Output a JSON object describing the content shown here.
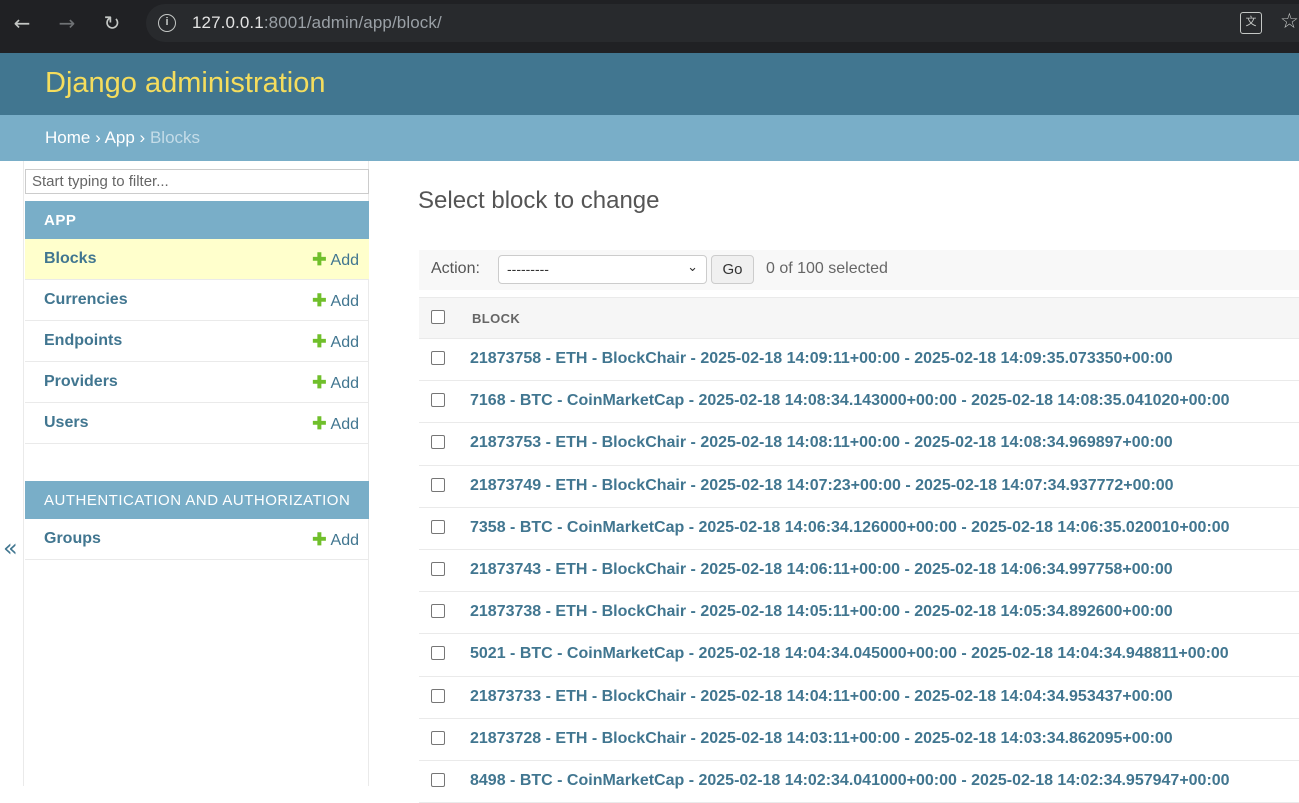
{
  "browser": {
    "url_host": "127.0.0.1",
    "url_rest": ":8001/admin/app/block/"
  },
  "header": {
    "site_name": "Django administration"
  },
  "breadcrumbs": {
    "home": "Home",
    "app": "App",
    "current": "Blocks",
    "separator": "›"
  },
  "sidebar": {
    "toggle_label": "«",
    "filter_placeholder": "Start typing to filter...",
    "modules": [
      {
        "caption": "APP",
        "models": [
          {
            "name": "Blocks",
            "add": "Add",
            "current": true
          },
          {
            "name": "Currencies",
            "add": "Add"
          },
          {
            "name": "Endpoints",
            "add": "Add"
          },
          {
            "name": "Providers",
            "add": "Add"
          },
          {
            "name": "Users",
            "add": "Add"
          }
        ]
      },
      {
        "caption": "AUTHENTICATION AND AUTHORIZATION",
        "models": [
          {
            "name": "Groups",
            "add": "Add"
          }
        ]
      }
    ]
  },
  "content": {
    "title": "Select block to change",
    "action_label": "Action:",
    "action_value": "---------",
    "go_label": "Go",
    "counter": "0 of 100 selected",
    "column_header": "BLOCK",
    "rows": [
      "21873758 - ETH - BlockChair - 2025-02-18 14:09:11+00:00 - 2025-02-18 14:09:35.073350+00:00",
      "7168 - BTC - CoinMarketCap - 2025-02-18 14:08:34.143000+00:00 - 2025-02-18 14:08:35.041020+00:00",
      "21873753 - ETH - BlockChair - 2025-02-18 14:08:11+00:00 - 2025-02-18 14:08:34.969897+00:00",
      "21873749 - ETH - BlockChair - 2025-02-18 14:07:23+00:00 - 2025-02-18 14:07:34.937772+00:00",
      "7358 - BTC - CoinMarketCap - 2025-02-18 14:06:34.126000+00:00 - 2025-02-18 14:06:35.020010+00:00",
      "21873743 - ETH - BlockChair - 2025-02-18 14:06:11+00:00 - 2025-02-18 14:06:34.997758+00:00",
      "21873738 - ETH - BlockChair - 2025-02-18 14:05:11+00:00 - 2025-02-18 14:05:34.892600+00:00",
      "5021 - BTC - CoinMarketCap - 2025-02-18 14:04:34.045000+00:00 - 2025-02-18 14:04:34.948811+00:00",
      "21873733 - ETH - BlockChair - 2025-02-18 14:04:11+00:00 - 2025-02-18 14:04:34.953437+00:00",
      "21873728 - ETH - BlockChair - 2025-02-18 14:03:11+00:00 - 2025-02-18 14:03:34.862095+00:00",
      "8498 - BTC - CoinMarketCap - 2025-02-18 14:02:34.041000+00:00 - 2025-02-18 14:02:34.957947+00:00"
    ]
  },
  "colors": {
    "header_bg": "#417690",
    "breadcrumb_bg": "#79aec8",
    "branding": "#f5dd5d",
    "link": "#417690",
    "add_plus": "#70bf2b",
    "current_row": "#ffffcc"
  }
}
